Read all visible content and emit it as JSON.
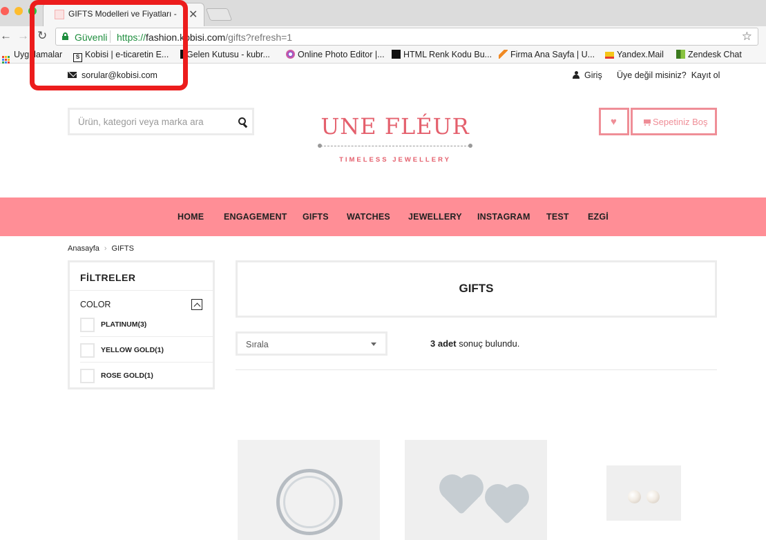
{
  "browser": {
    "tab_title": "GIFTS Modelleri ve Fiyatları -",
    "tab_close": "✕",
    "secure_label": "Güvenli",
    "url_scheme": "https://",
    "url_host": "fashion.kobisi.com",
    "url_path": "/gifts?refresh=1",
    "bookmarks": [
      {
        "label": "Uygulamalar"
      },
      {
        "label": "Kobisi | e-ticaretin E..."
      },
      {
        "label": "Gelen Kutusu - kubr..."
      },
      {
        "label": "Online Photo Editor |..."
      },
      {
        "label": "HTML Renk Kodu Bu..."
      },
      {
        "label": "Firma Ana Sayfa | U..."
      },
      {
        "label": "Yandex.Mail"
      },
      {
        "label": "Zendesk Chat"
      }
    ]
  },
  "topbar": {
    "email": "sorular@kobisi.com",
    "login": "Giriş",
    "register_prompt": "Üye değil misiniz?",
    "register": "Kayıt ol"
  },
  "header": {
    "search_placeholder": "Ürün, kategori veya marka ara",
    "logo_main": "UNE FLÉUR",
    "logo_tagline": "TIMELESS JEWELLERY",
    "cart_label": "Sepetiniz Boş"
  },
  "nav": {
    "items": [
      "HOME",
      "ENGAGEMENT",
      "GIFTS",
      "WATCHES",
      "JEWELLERY",
      "INSTAGRAM",
      "TEST",
      "EZGİ"
    ]
  },
  "breadcrumb": {
    "home": "Anasayfa",
    "sep": "›",
    "current": "GIFTS"
  },
  "filters": {
    "title": "FİLTRELER",
    "group": "COLOR",
    "options": [
      "PLATINUM(3)",
      "YELLOW GOLD(1)",
      "ROSE GOLD(1)"
    ]
  },
  "content": {
    "title": "GIFTS",
    "sort_label": "Sırala",
    "result_count": "3 adet",
    "result_suffix": " sonuç bulundu."
  },
  "colors": {
    "brand_pink": "#ff8e96",
    "logo_pink": "#e4606d",
    "secure_green": "#1e8e3e",
    "highlight_red": "#ec1c1c"
  }
}
